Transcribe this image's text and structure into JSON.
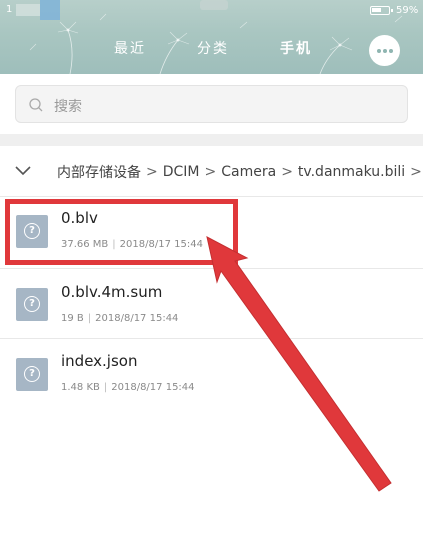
{
  "status_bar": {
    "left_text": "1",
    "battery_percent": "59%",
    "battery_level": 0.59
  },
  "tabs": [
    {
      "label": "最近",
      "active": false
    },
    {
      "label": "分类",
      "active": false
    },
    {
      "label": "手机",
      "active": true
    }
  ],
  "search": {
    "placeholder": "搜索"
  },
  "breadcrumb": {
    "items": [
      "内部存储设备",
      "DCIM",
      "Camera",
      "tv.danmaku.bili"
    ]
  },
  "files": [
    {
      "name": "0.blv",
      "size": "37.66 MB",
      "date": "2018/8/17 15:44"
    },
    {
      "name": "0.blv.4m.sum",
      "size": "19 B",
      "date": "2018/8/17 15:44"
    },
    {
      "name": "index.json",
      "size": "1.48 KB",
      "date": "2018/8/17 15:44"
    }
  ],
  "icons": {
    "more": "more-horizontal-icon",
    "search": "search-icon",
    "collapse": "chevron-down-icon",
    "file": "unknown-file-icon"
  },
  "colors": {
    "header": "#a9c6c1",
    "annotation": "#e0383b",
    "file_icon": "#a6b6c5"
  }
}
